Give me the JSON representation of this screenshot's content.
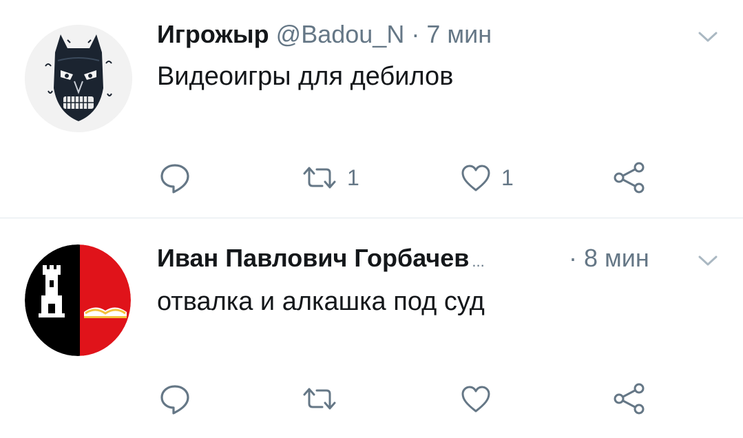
{
  "tweets": [
    {
      "name": "Игрожыр",
      "handle": "@Badou_N",
      "separator": "·",
      "time": "7 мин",
      "text": "Видеоигры для дебилов",
      "retweets": "1",
      "likes": "1",
      "avatar_icon": "masked-face-icon"
    },
    {
      "name": "Иван Павлович Горбачев",
      "ellipsis": "...",
      "separator": "·",
      "time": "8 мин",
      "text": "отвалка и алкашка под суд",
      "avatar_icon": "tower-and-book-emblem-icon",
      "avatar_colors": {
        "left": "#000000",
        "right": "#e0131a"
      }
    }
  ],
  "colors": {
    "icon": "#657786",
    "divider": "#e1e8ed"
  }
}
